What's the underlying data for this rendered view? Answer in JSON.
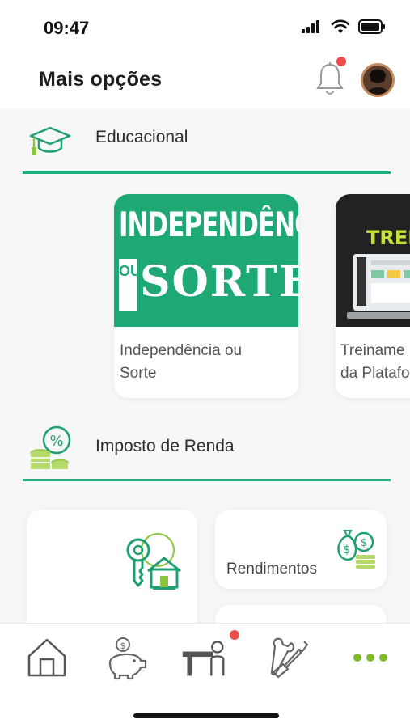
{
  "status_bar": {
    "time": "09:47",
    "icons": [
      "signal-icon",
      "wifi-icon",
      "battery-icon"
    ]
  },
  "header": {
    "title": "Mais opções",
    "has_notification": true
  },
  "sections": [
    {
      "title": "Educacional",
      "icon": "graduation-cap-icon",
      "cards": [
        {
          "banner_title": "INDEPENDÊNCIA",
          "banner_connector": "OU",
          "banner_word": "SORTE",
          "caption_line1": "Independência ou",
          "caption_line2": "Sorte"
        },
        {
          "banner_title": "TREIN",
          "caption_line1": "Treiname",
          "caption_line2": "da Platafo"
        }
      ]
    },
    {
      "title": "Imposto de Renda",
      "icon": "coins-percent-icon",
      "cards": [
        {
          "icon": "key-house-icon",
          "caption": ""
        },
        {
          "icon": "money-bag-coins-icon",
          "caption": "Rendimentos"
        }
      ]
    }
  ],
  "bottom_nav": {
    "items": [
      {
        "icon": "home-icon"
      },
      {
        "icon": "piggy-bank-icon"
      },
      {
        "icon": "desk-person-icon",
        "has_notification": true
      },
      {
        "icon": "tools-icon"
      },
      {
        "icon": "more-dots-icon",
        "active": true
      }
    ]
  },
  "colors": {
    "accent": "#1cae7c",
    "notification": "#f04b4b",
    "more_active": "#7dbb2a"
  }
}
